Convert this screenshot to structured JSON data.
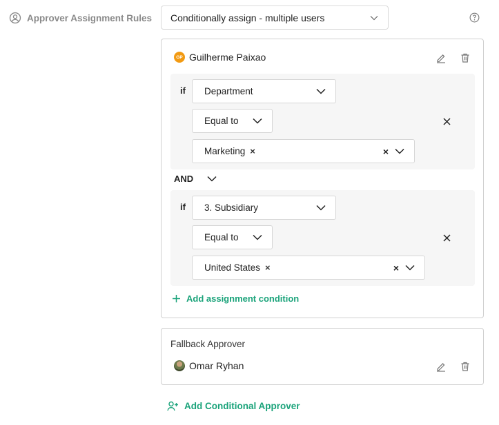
{
  "field": {
    "label": "Approver Assignment Rules",
    "icon": "user-circle-icon",
    "mode_value": "Conditionally assign - multiple users",
    "help_icon": "help-circle-icon"
  },
  "approver": {
    "initials": "GP",
    "name": "Guilherme Paixao",
    "avatar_color": "#f29a12",
    "conditions": [
      {
        "if_label": "if",
        "field_value": "Department",
        "operator_value": "Equal to",
        "chip_value": "Marketing"
      },
      {
        "if_label": "if",
        "field_value": "3. Subsidiary",
        "operator_value": "Equal to",
        "chip_value": "United States"
      }
    ],
    "joiner": "AND",
    "add_condition_label": "Add assignment condition"
  },
  "fallback": {
    "title": "Fallback Approver",
    "name": "Omar Ryhan"
  },
  "add_conditional_approver_label": "Add Conditional Approver",
  "colors": {
    "accent": "#1aa37a",
    "border": "#cfcfcf",
    "condition_bg": "#f6f6f6"
  }
}
